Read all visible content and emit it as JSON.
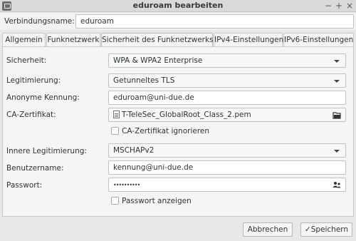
{
  "window": {
    "title": "eduroam bearbeiten",
    "controls": {
      "minimize": "−",
      "maximize": "+",
      "close": "×"
    }
  },
  "connection": {
    "name_label": "Verbindungsname:",
    "name_value": "eduroam"
  },
  "tabs": [
    {
      "label": "Allgemein",
      "active": false
    },
    {
      "label": "Funknetzwerk",
      "active": false
    },
    {
      "label": "Sicherheit des Funknetzwerks",
      "active": true
    },
    {
      "label": "IPv4-Einstellungen",
      "active": false
    },
    {
      "label": "IPv6-Einstellungen",
      "active": false
    }
  ],
  "security": {
    "security_label": "Sicherheit:",
    "security_value": "WPA & WPA2 Enterprise",
    "auth_label": "Legitimierung:",
    "auth_value": "Getunneltes TLS",
    "anon_label": "Anonyme Kennung:",
    "anon_value": "eduroam@uni-due.de",
    "ca_label": "CA-Zertifikat:",
    "ca_value": "T-TeleSec_GlobalRoot_Class_2.pem",
    "ca_ignore_label": "CA-Zertifikat ignorieren",
    "inner_label": "Innere Legitimierung:",
    "inner_value": "MSCHAPv2",
    "user_label": "Benutzername:",
    "user_value": "kennung@uni-due.de",
    "pass_label": "Passwort:",
    "pass_value": "••••••••••",
    "show_pass_label": "Passwort anzeigen"
  },
  "buttons": {
    "cancel": "Abbrechen",
    "save": "Speichern",
    "save_check": "✓"
  },
  "icons": {
    "app": "network-icon",
    "ca_file": "certificate-file-icon",
    "ca_browse": "folder-open-icon",
    "password_users": "user-select-icon"
  }
}
